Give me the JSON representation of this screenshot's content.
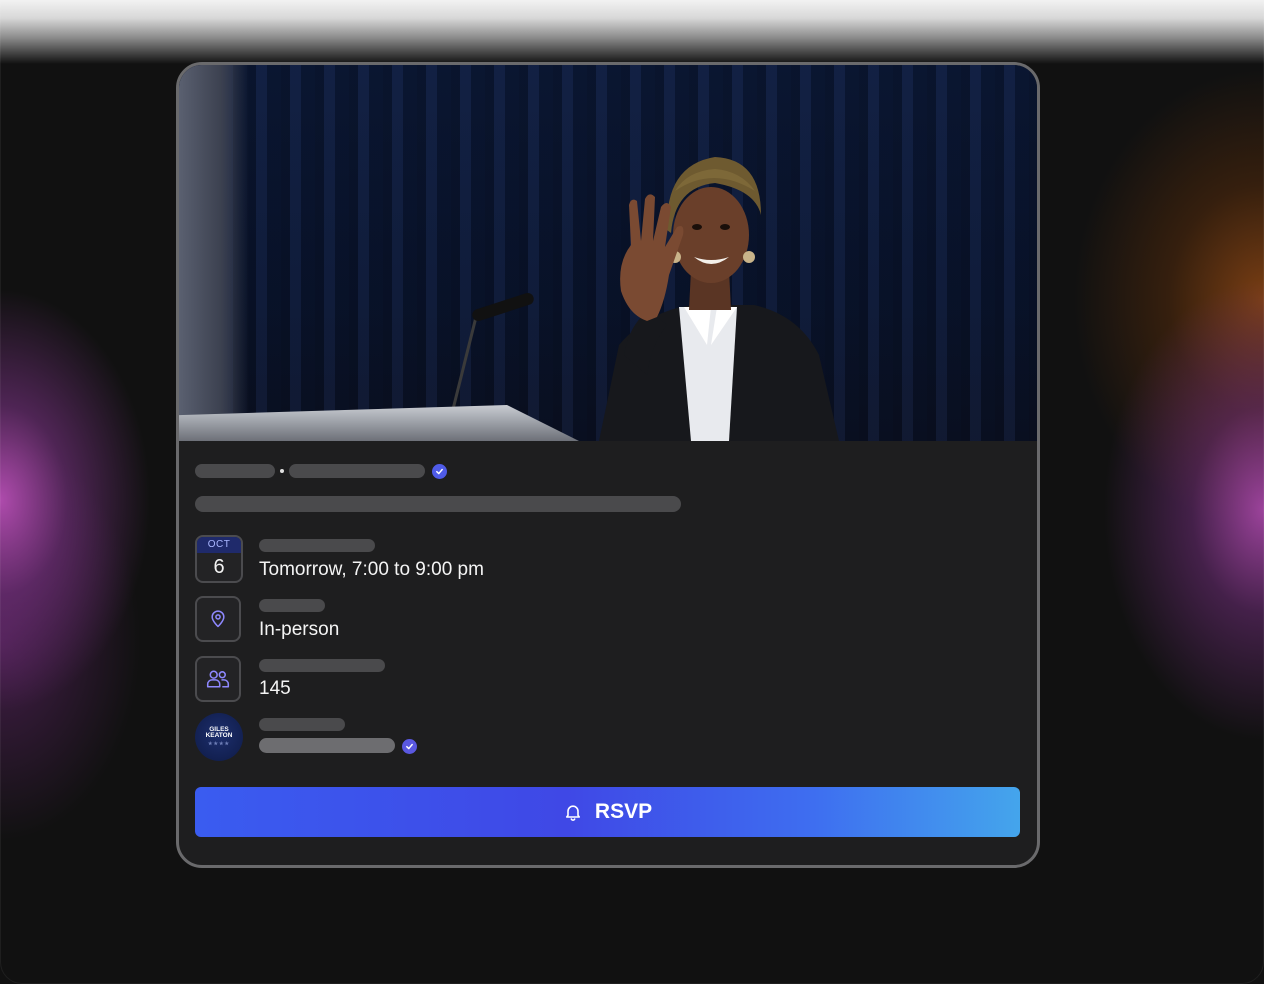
{
  "event": {
    "date": {
      "month": "OCT",
      "day": "6"
    },
    "time_text": "Tomorrow, 7:00 to 9:00 pm",
    "location_text": "In-person",
    "attendees_count": "145",
    "organizer": {
      "logo_text_line1": "GILES",
      "logo_text_line2": "KEATON",
      "logo_stars": "★★★★"
    }
  },
  "actions": {
    "rsvp_label": "RSVP"
  },
  "icons": {
    "calendar": "calendar-icon",
    "location": "map-pin-icon",
    "attendees": "users-icon",
    "verified": "verified-badge-icon",
    "rsvp": "bell-icon"
  },
  "colors": {
    "accent": "#4f5be8",
    "button_gradient_start": "#3a5cf0",
    "button_gradient_end": "#44a5ec",
    "card_bg": "#1e1e1f",
    "skeleton": "#4a4a4c"
  }
}
